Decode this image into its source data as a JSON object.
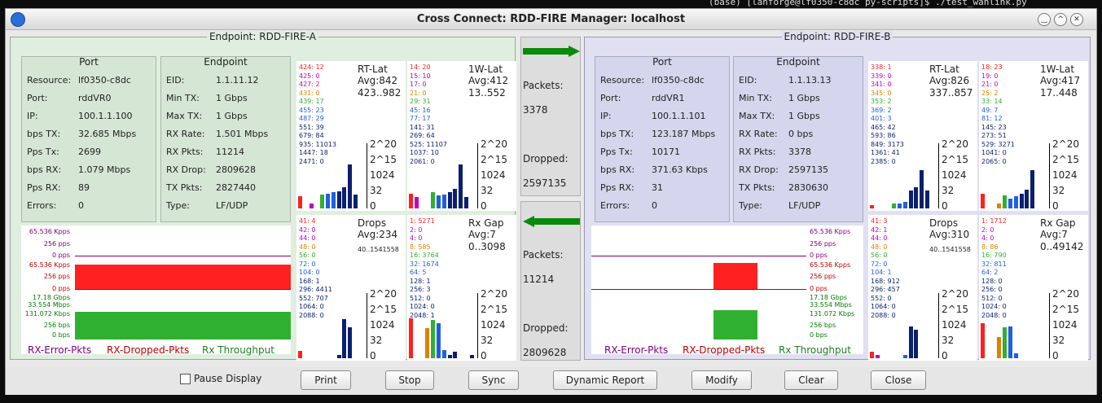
{
  "background_terminal": "(base) [lanforge@lf0350-c8dc py-scripts]$ ./test_wanlink.py",
  "window_title": "Cross Connect: RDD-FIRE  Manager: localhost",
  "endpointA": {
    "title": "Endpoint: RDD-FIRE-A",
    "port_title": "Port",
    "port": [
      [
        "Resource:",
        "lf0350-c8dc"
      ],
      [
        "Port:",
        "rddVR0"
      ],
      [
        "IP:",
        "100.1.1.100"
      ],
      [
        "bps TX:",
        "32.685 Mbps"
      ],
      [
        "Pps Tx:",
        "2699"
      ],
      [
        "bps RX:",
        "1.079 Mbps"
      ],
      [
        "Pps RX:",
        "89"
      ],
      [
        "Errors:",
        "0"
      ]
    ],
    "ep_title": "Endpoint",
    "ep": [
      [
        "EID:",
        "1.1.11.12"
      ],
      [
        "Min TX:",
        "1 Gbps"
      ],
      [
        "Max TX:",
        "1 Gbps"
      ],
      [
        "RX Rate:",
        "1.501 Mbps"
      ],
      [
        "RX Pkts:",
        "11214"
      ],
      [
        "RX Drop:",
        "2809628"
      ],
      [
        "TX Pkts:",
        "2827440"
      ],
      [
        "Type:",
        "LF/UDP"
      ]
    ],
    "rtlat": {
      "title": "RT-Lat",
      "avg": "Avg:842",
      "range": "423..982",
      "hist": [
        "424: 12",
        "425: 0",
        "427: 2",
        "431: 0",
        "439: 17",
        "455: 23",
        "487: 29",
        "551: 39",
        "679: 84",
        "935: 11013",
        "1447: 18",
        "2471: 0"
      ]
    },
    "owlat": {
      "title": "1W-Lat",
      "avg": "Avg:412",
      "range": "13..552",
      "hist": [
        "14: 20",
        "15: 10",
        "17: 0",
        "21: 0",
        "29: 31",
        "45: 16",
        "77: 17",
        "141: 31",
        "269: 64",
        "525: 11107",
        "1037: 10",
        "2061: 0"
      ]
    },
    "drops": {
      "title": "Drops",
      "avg": "Avg:234",
      "range": "40..1541558",
      "hist": [
        "41: 4",
        "42: 0",
        "44: 0",
        "48: 0",
        "56: 0",
        "72: 0",
        "104: 0",
        "168: 1",
        "296: 4411",
        "552: 707",
        "1064: 0",
        "2088: 0"
      ]
    },
    "rxgap": {
      "title": "Rx Gap",
      "avg": "Avg:7",
      "range": "0..3098",
      "hist": [
        "1: 5271",
        "2: 0",
        "4: 0",
        "8: 585",
        "16: 3764",
        "32: 1674",
        "64: 5",
        "128: 1",
        "256: 3",
        "512: 0",
        "1024: 0",
        "2048: 1"
      ]
    },
    "axis": [
      "2^20",
      "2^15",
      "1024",
      "32",
      "0"
    ],
    "graph_labels": [
      "65.536 Kpps",
      "256 pps",
      "0 pps",
      "65.536 Kpps",
      "256 pps",
      "0 pps",
      "17.18 Gbps",
      "33.554 Mbps",
      "131.072 Kbps",
      "256 bps",
      "0 bps"
    ],
    "legend": [
      "RX-Error-Pkts",
      "RX-Dropped-Pkts",
      "Rx Throughput"
    ]
  },
  "endpointB": {
    "title": "Endpoint: RDD-FIRE-B",
    "port_title": "Port",
    "port": [
      [
        "Resource:",
        "lf0350-c8dc"
      ],
      [
        "Port:",
        "rddVR1"
      ],
      [
        "IP:",
        "100.1.1.101"
      ],
      [
        "bps TX:",
        "123.187 Mbps"
      ],
      [
        "Pps Tx:",
        "10171"
      ],
      [
        "bps RX:",
        "371.63 Kbps"
      ],
      [
        "Pps RX:",
        "31"
      ],
      [
        "Errors:",
        "0"
      ]
    ],
    "ep_title": "Endpoint",
    "ep": [
      [
        "EID:",
        "1.1.13.13"
      ],
      [
        "Min TX:",
        "1 Gbps"
      ],
      [
        "Max TX:",
        "1 Gbps"
      ],
      [
        "RX Rate:",
        "0 bps"
      ],
      [
        "RX Pkts:",
        "3378"
      ],
      [
        "RX Drop:",
        "2597135"
      ],
      [
        "TX Pkts:",
        "2830630"
      ],
      [
        "Type:",
        "LF/UDP"
      ]
    ],
    "rtlat": {
      "title": "RT-Lat",
      "avg": "Avg:826",
      "range": "337..857",
      "hist": [
        "338: 1",
        "339: 0",
        "341: 0",
        "345: 0",
        "353: 2",
        "369: 2",
        "401: 3",
        "465: 42",
        "593: 86",
        "849: 3173",
        "1361: 41",
        "2385: 0"
      ]
    },
    "owlat": {
      "title": "1W-Lat",
      "avg": "Avg:417",
      "range": "17..448",
      "hist": [
        "18: 23",
        "19: 0",
        "21: 0",
        "25: 2",
        "33: 14",
        "49: 7",
        "81: 12",
        "145: 23",
        "273: 51",
        "529: 3271",
        "1041: 0",
        "2065: 0"
      ]
    },
    "drops": {
      "title": "Drops",
      "avg": "Avg:310",
      "range": "40..1541558",
      "hist": [
        "41: 3",
        "42: 1",
        "44: 0",
        "48: 0",
        "56: 0",
        "72: 0",
        "104: 1",
        "168: 912",
        "296: 457",
        "552: 0",
        "1064: 0",
        "2088: 0"
      ]
    },
    "rxgap": {
      "title": "Rx Gap",
      "avg": "Avg:7",
      "range": "0..49142",
      "hist": [
        "1: 1712",
        "2: 0",
        "4: 0",
        "8: 86",
        "16: 790",
        "32: 811",
        "64: 2",
        "128: 0",
        "256: 0",
        "512: 0",
        "1024: 0",
        "2048: 0"
      ]
    },
    "axis": [
      "2^20",
      "2^15",
      "1024",
      "32",
      "0"
    ],
    "graph_labels": [
      "65.536 Kpps",
      "256 pps",
      "0 pps",
      "65.536 Kpps",
      "256 pps",
      "0 pps",
      "17.18 Gbps",
      "33.554 Mbps",
      "131.072 Kbps",
      "256 bps",
      "0 bps"
    ],
    "legend": [
      "RX-Error-Pkts",
      "RX-Dropped-Pkts",
      "Rx Throughput"
    ]
  },
  "middle": {
    "top": {
      "packets_label": "Packets:",
      "packets": "3378",
      "dropped_label": "Dropped:",
      "dropped": "2597135"
    },
    "bottom": {
      "packets_label": "Packets:",
      "packets": "11214",
      "dropped_label": "Dropped:",
      "dropped": "2809628"
    }
  },
  "controls": {
    "pause": "Pause Display",
    "print": "Print",
    "stop": "Stop",
    "sync": "Sync",
    "dynamic": "Dynamic Report",
    "modify": "Modify",
    "clear": "Clear",
    "close": "Close"
  },
  "colors": {
    "red": "#ff2020",
    "green": "#30b030",
    "navy": "#0a1f6e",
    "blue": "#2060e0",
    "orange": "#e08000",
    "magenta": "#c000c0"
  }
}
